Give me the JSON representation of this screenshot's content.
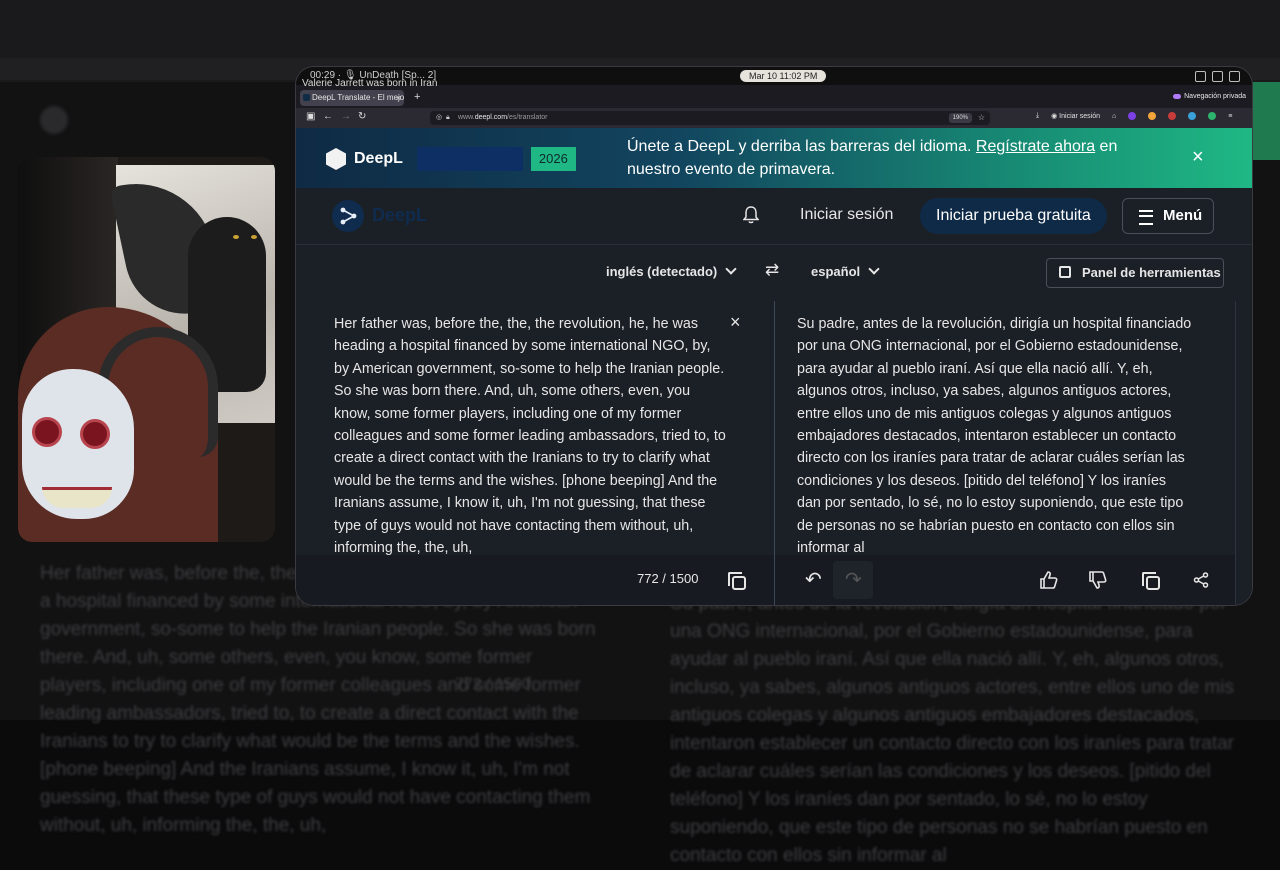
{
  "system_bar": {
    "left_text": "00:29 · 🎙 UnDeath [Sp... 2]",
    "video_title": "Valerie Jarrett was born in Iran",
    "date_time": "Mar 10  11:02 PM"
  },
  "browser": {
    "tab_title": "DeepL Translate - El mejor tr",
    "tab_close": "×",
    "new_tab": "+",
    "private_label": "Navegación privada",
    "url_prefix": "www.",
    "url_domain": "deepl.com",
    "url_path": "/es/translator",
    "zoom": "190%",
    "signin_toolbar": "Iniciar sesión"
  },
  "banner": {
    "logo_word": "DeepL",
    "year_badge": "2026",
    "text_before_link": "Únete a DeepL y derriba las barreras del idioma. ",
    "link": "Regístrate ahora",
    "text_after_link": " en nuestro evento de primavera.",
    "close": "×"
  },
  "appbar": {
    "logo_text": "DeepL",
    "signin": "Iniciar sesión",
    "trial": "Iniciar prueba gratuita",
    "menu": "Menú"
  },
  "langbar": {
    "source_lang": "inglés (detectado)",
    "swap": "⇄",
    "target_lang": "español",
    "tools": "Panel de herramientas"
  },
  "source": {
    "text": "Her father was, before the, the, the revolution, he, he was heading a hospital financed by some international NGO, by, by American government, so-some to help the Iranian people. So she was born there. And, uh, some others, even, you know, some former players, including one of my former colleagues and some former leading ambassadors, tried to, to create a direct contact with the Iranians to try to clarify what would be the terms and the wishes. [phone beeping] And the Iranians assume, I know it, uh, I'm not guessing, that these type of guys would not have contacting them without, uh, informing the, the, uh,",
    "clear": "×",
    "char_count": "772 / 1500"
  },
  "target": {
    "text": "Su padre, antes de la revolución, dirigía un hospital financiado por una ONG internacional, por el Gobierno estadounidense, para ayudar al pueblo iraní. Así que ella nació allí. Y, eh, algunos otros, incluso, ya sabes, algunos antiguos actores, entre ellos uno de mis antiguos colegas y algunos antiguos embajadores destacados, intentaron establecer un contacto directo con los iraníes para tratar de aclarar cuáles serían las condiciones y los deseos. [pitido del teléfono] Y los iraníes dan por sentado, lo sé, no lo estoy suponiendo, que este tipo de personas no se habrían puesto en contacto con ellos sin informar al"
  },
  "footer_icons": {
    "undo": "↶",
    "redo": "↷"
  },
  "colors": {
    "banner_start": "#0f2a44",
    "banner_end": "#1fb884",
    "page_bg": "#1b1f26",
    "trial_bg": "#0f2a47",
    "accent_green": "#1fb884"
  }
}
